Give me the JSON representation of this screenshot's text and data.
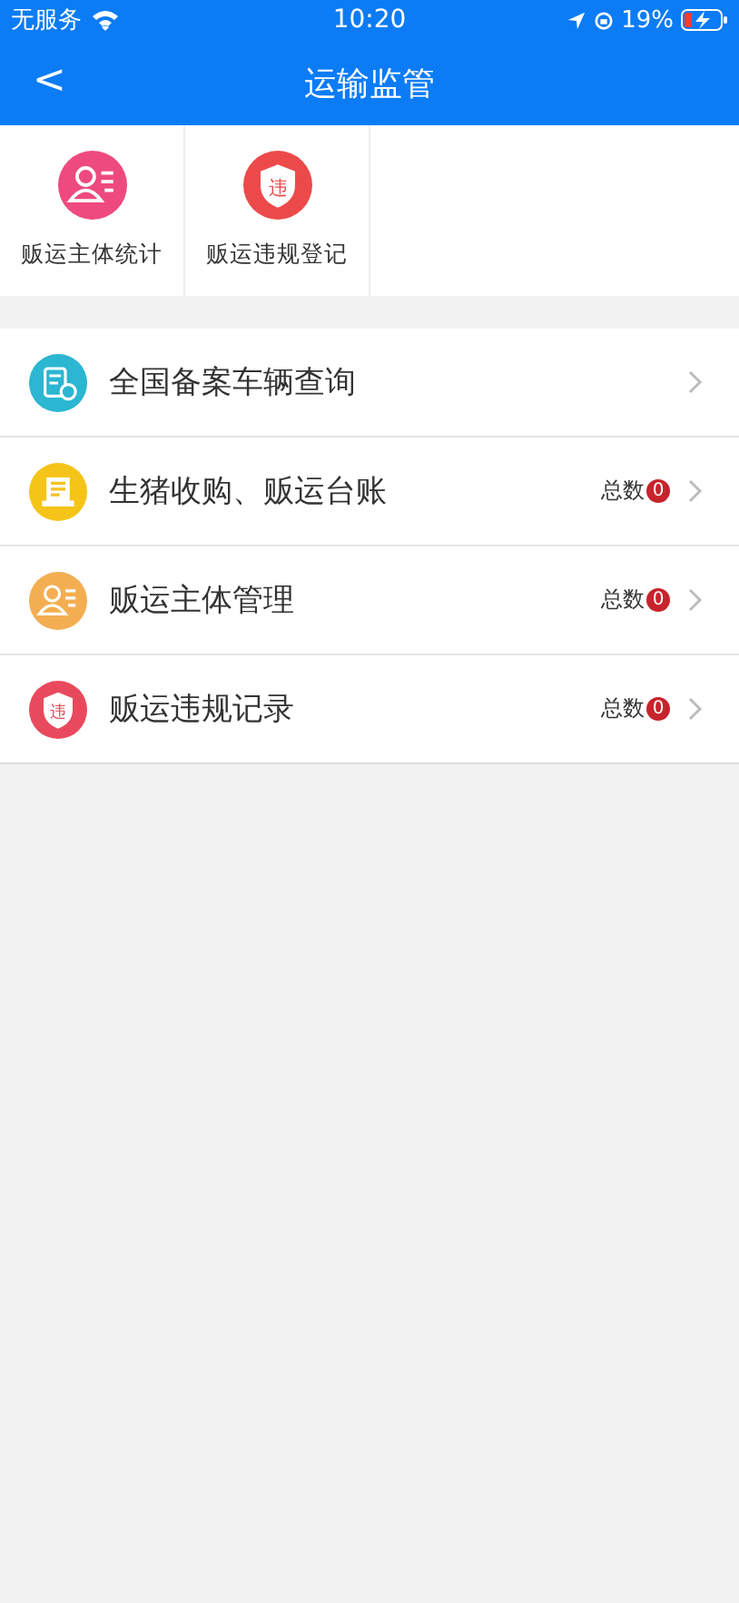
{
  "status_bar": {
    "carrier": "无服务",
    "time": "10:20",
    "battery": "19%"
  },
  "header": {
    "back": "<",
    "title": "运输监管"
  },
  "tiles": [
    {
      "label": "贩运主体统计",
      "kind": "person",
      "color": "#ee4a7d"
    },
    {
      "label": "贩运违规登记",
      "kind": "shield",
      "color": "#ec4a4a",
      "icon_text": "违"
    }
  ],
  "menu": [
    {
      "label": "全国备案车辆查询",
      "kind": "document",
      "color": "#2bb6d1"
    },
    {
      "label": "生猪收购、贩运台账",
      "kind": "ledger",
      "color": "#f5c419",
      "count_label": "总数",
      "count": "0"
    },
    {
      "label": "贩运主体管理",
      "kind": "person",
      "color": "#f4ae52",
      "count_label": "总数",
      "count": "0"
    },
    {
      "label": "贩运违规记录",
      "kind": "shield",
      "color": "#e9495c",
      "icon_text": "违",
      "count_label": "总数",
      "count": "0"
    }
  ]
}
